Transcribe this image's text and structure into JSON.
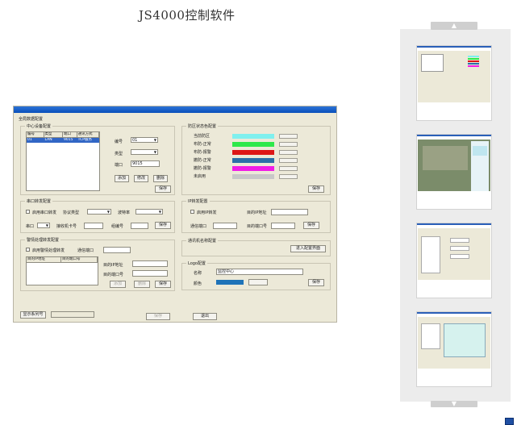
{
  "page": {
    "title": "JS4000控制软件"
  },
  "window": {
    "title": "全局数据配置",
    "center_group": {
      "title": "中心设备配置",
      "columns": [
        "编号",
        "类型",
        "端口",
        "通讯方式"
      ],
      "rows": [
        [
          "01",
          "LAN",
          "9015",
          "TCP服务"
        ]
      ],
      "no_label": "编号",
      "no_value": "01",
      "type_label": "类型",
      "type_value": "",
      "port_label": "端口",
      "port_value": "9015",
      "add": "添加",
      "modify": "修改",
      "delete": "删除",
      "save": "保存"
    },
    "zone_color_group": {
      "title": "防区状态色配置",
      "items": [
        {
          "label": "当前防区",
          "color": "#7ff0ee"
        },
        {
          "label": "布防-正常",
          "color": "#2ee84a"
        },
        {
          "label": "布防-报警",
          "color": "#dd1616"
        },
        {
          "label": "撤防-正常",
          "color": "#2b6fa8"
        },
        {
          "label": "撤防-报警",
          "color": "#f01ce6"
        },
        {
          "label": "未启用",
          "color": "#c8c8c8"
        }
      ],
      "save": "保存"
    },
    "serial_group": {
      "title": "串口转发配置",
      "enable": "启用串口转发",
      "protocol_label": "协议类型",
      "baud_label": "波特率",
      "port_label": "串口",
      "receiver_label": "接收机卡号",
      "group_label": "组编号",
      "save": "保存"
    },
    "ip_group": {
      "title": "IP转发配置",
      "enable": "启用IP转发",
      "dest_ip_label": "目的IP地址",
      "comm_port_label": "通信端口",
      "dest_port_label": "目的端口号",
      "save": "保存"
    },
    "alarm_group": {
      "title": "警情处理转发配置",
      "enable": "启用警情处理转发",
      "comm_port_label": "通信端口",
      "columns": [
        "目的IP地址",
        "目的端口号"
      ],
      "dest_ip_label": "目的IP地址",
      "dest_port_label": "目的端口号",
      "add": "添加",
      "delete": "删除",
      "save": "保存"
    },
    "terminal_group": {
      "title": "通讯机名称配置",
      "enter": "进入配置界面"
    },
    "logo_group": {
      "title": "Logo配置",
      "name_label": "名称",
      "name_value": "监控中心",
      "color_label": "颜色",
      "color": "#1f73b8",
      "save": "保存"
    },
    "bottom": {
      "show_serial": "显示系列号",
      "save": "保存",
      "exit": "退出"
    }
  },
  "thumbnails": {
    "up_arrow": "▲",
    "down_arrow": "▼",
    "count": 4
  }
}
